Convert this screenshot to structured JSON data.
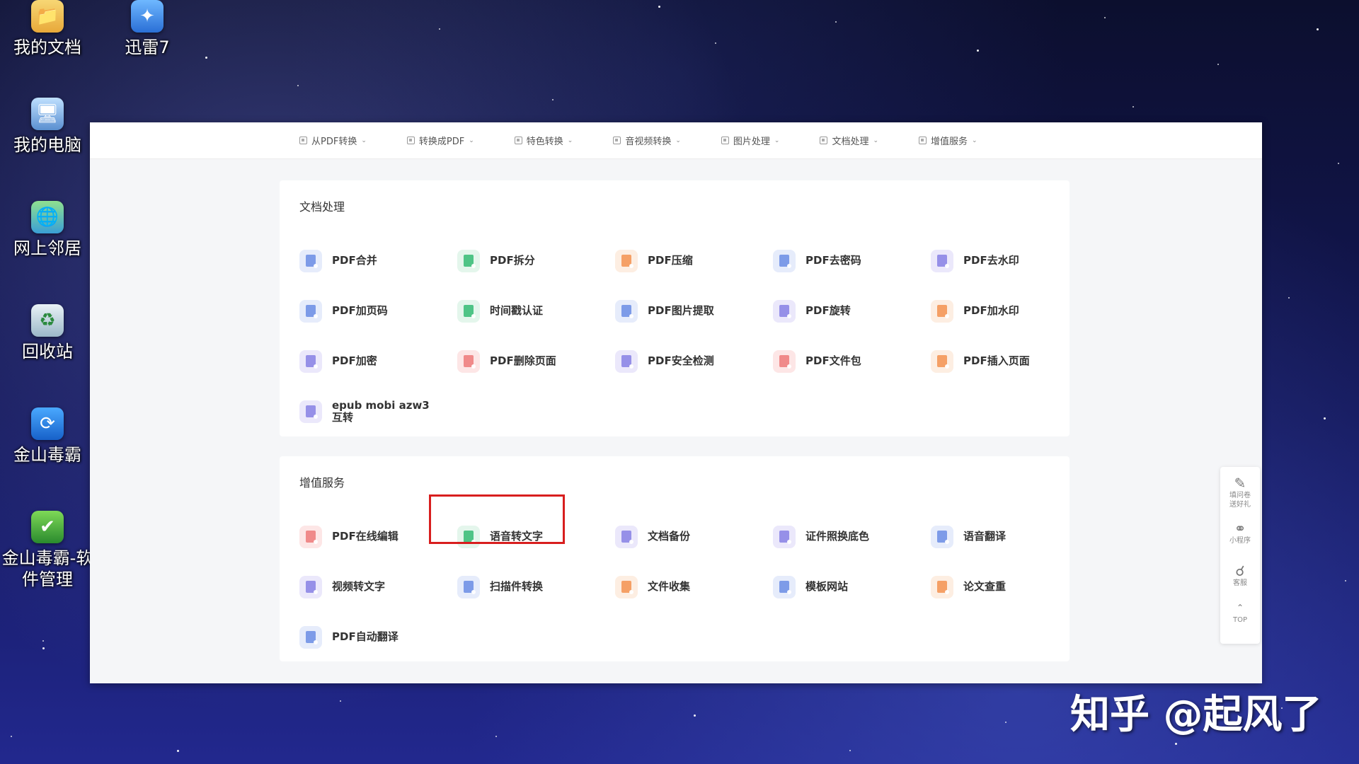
{
  "desktop": {
    "icons": [
      {
        "label": "我的文档",
        "icon": "folder-icon"
      },
      {
        "label": "迅雷7",
        "icon": "thunder-icon"
      },
      {
        "label": "我的电脑",
        "icon": "computer-icon"
      },
      {
        "label": "网上邻居",
        "icon": "network-icon"
      },
      {
        "label": "回收站",
        "icon": "recycle-bin-icon"
      },
      {
        "label": "金山毒霸",
        "icon": "antivirus-icon"
      },
      {
        "label": "金山毒霸-软件管理",
        "icon": "software-manager-icon"
      }
    ]
  },
  "nav": {
    "items": [
      {
        "label": "从PDF转换"
      },
      {
        "label": "转换成PDF"
      },
      {
        "label": "特色转换"
      },
      {
        "label": "音视频转换"
      },
      {
        "label": "图片处理"
      },
      {
        "label": "文档处理"
      },
      {
        "label": "增值服务"
      }
    ]
  },
  "sections": [
    {
      "title": "文档处理",
      "tools": [
        {
          "label": "PDF合并",
          "color": "blue"
        },
        {
          "label": "PDF拆分",
          "color": "green"
        },
        {
          "label": "PDF压缩",
          "color": "orange"
        },
        {
          "label": "PDF去密码",
          "color": "blue"
        },
        {
          "label": "PDF去水印",
          "color": "purple"
        },
        {
          "label": "PDF加页码",
          "color": "blue"
        },
        {
          "label": "时间戳认证",
          "color": "green"
        },
        {
          "label": "PDF图片提取",
          "color": "blue"
        },
        {
          "label": "PDF旋转",
          "color": "purple"
        },
        {
          "label": "PDF加水印",
          "color": "orange"
        },
        {
          "label": "PDF加密",
          "color": "purple"
        },
        {
          "label": "PDF删除页面",
          "color": "red"
        },
        {
          "label": "PDF安全检测",
          "color": "purple"
        },
        {
          "label": "PDF文件包",
          "color": "red"
        },
        {
          "label": "PDF插入页面",
          "color": "orange"
        },
        {
          "label": "epub mobi azw3 互转",
          "color": "purple"
        }
      ]
    },
    {
      "title": "增值服务",
      "tools": [
        {
          "label": "PDF在线编辑",
          "color": "red"
        },
        {
          "label": "语音转文字",
          "color": "green"
        },
        {
          "label": "文档备份",
          "color": "purple"
        },
        {
          "label": "证件照换底色",
          "color": "purple"
        },
        {
          "label": "语音翻译",
          "color": "blue"
        },
        {
          "label": "视频转文字",
          "color": "purple"
        },
        {
          "label": "扫描件转换",
          "color": "blue"
        },
        {
          "label": "文件收集",
          "color": "orange"
        },
        {
          "label": "模板网站",
          "color": "blue"
        },
        {
          "label": "论文查重",
          "color": "orange"
        },
        {
          "label": "PDF自动翻译",
          "color": "blue"
        }
      ]
    }
  ],
  "floatbar": {
    "survey": "填问卷送好礼",
    "miniprogram": "小程序",
    "service": "客服",
    "top": "TOP"
  },
  "watermark": "知乎 @起风了",
  "colors": {
    "highlight": "#d81e1e",
    "background": "#14185a"
  }
}
